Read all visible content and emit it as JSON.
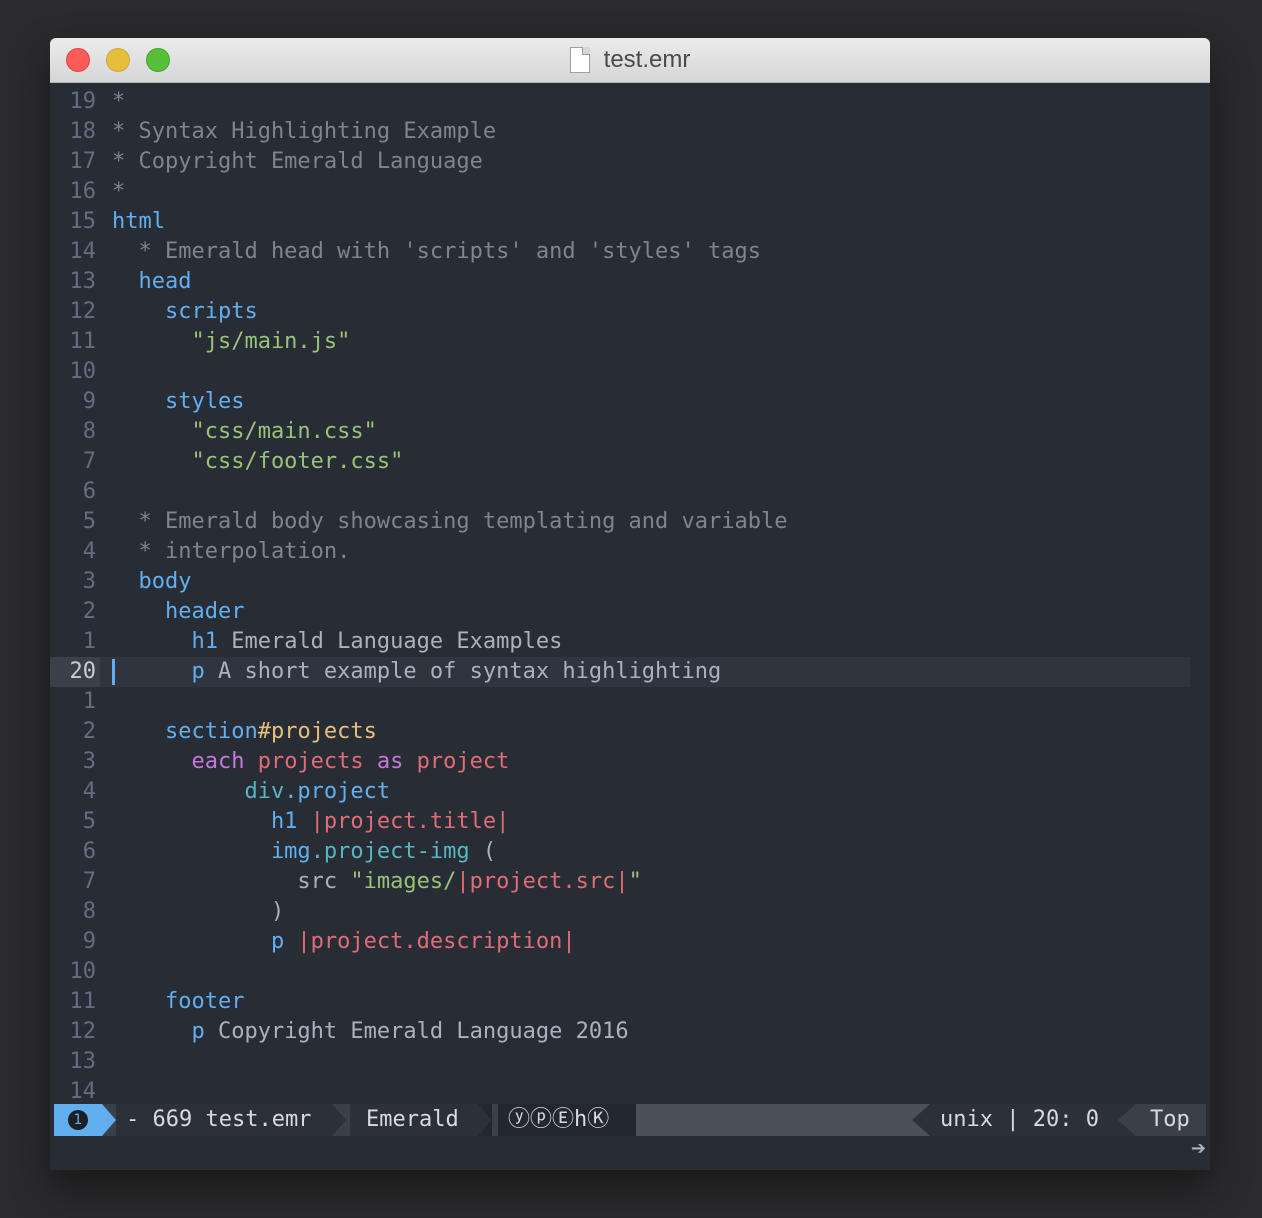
{
  "window": {
    "title": "test.emr"
  },
  "lines": [
    {
      "num": "19",
      "parts": [
        [
          "cm",
          "*"
        ]
      ]
    },
    {
      "num": "18",
      "parts": [
        [
          "cm",
          "* Syntax Highlighting Example"
        ]
      ]
    },
    {
      "num": "17",
      "parts": [
        [
          "cm",
          "* Copyright Emerald Language"
        ]
      ]
    },
    {
      "num": "16",
      "parts": [
        [
          "cm",
          "*"
        ]
      ]
    },
    {
      "num": "15",
      "parts": [
        [
          "kw",
          "html"
        ]
      ]
    },
    {
      "num": "14",
      "parts": [
        [
          "cm",
          "  * Emerald head with 'scripts' and 'styles' tags"
        ]
      ]
    },
    {
      "num": "13",
      "parts": [
        [
          "kw",
          "  head"
        ]
      ]
    },
    {
      "num": "12",
      "parts": [
        [
          "kw",
          "    scripts"
        ]
      ]
    },
    {
      "num": "11",
      "parts": [
        [
          "str",
          "      \"js/main.js\""
        ]
      ]
    },
    {
      "num": "10",
      "parts": []
    },
    {
      "num": "9",
      "parts": [
        [
          "kw",
          "    styles"
        ]
      ]
    },
    {
      "num": "8",
      "parts": [
        [
          "str",
          "      \"css/main.css\""
        ]
      ]
    },
    {
      "num": "7",
      "parts": [
        [
          "str",
          "      \"css/footer.css\""
        ]
      ]
    },
    {
      "num": "6",
      "parts": []
    },
    {
      "num": "5",
      "parts": [
        [
          "cm",
          "  * Emerald body showcasing templating and variable"
        ]
      ]
    },
    {
      "num": "4",
      "parts": [
        [
          "cm",
          "  * interpolation."
        ]
      ]
    },
    {
      "num": "3",
      "parts": [
        [
          "kw",
          "  body"
        ]
      ]
    },
    {
      "num": "2",
      "parts": [
        [
          "kw",
          "    header"
        ]
      ]
    },
    {
      "num": "1",
      "parts": [
        [
          "kw",
          "      h1"
        ],
        [
          "tx",
          " Emerald Language Examples"
        ]
      ]
    },
    {
      "num": "20",
      "current": true,
      "parts": [
        [
          "kw",
          "      p"
        ],
        [
          "tx",
          " A short example of syntax highlighting"
        ]
      ]
    },
    {
      "num": "1",
      "parts": []
    },
    {
      "num": "2",
      "parts": [
        [
          "kw",
          "    section"
        ],
        [
          "id",
          "#projects"
        ]
      ]
    },
    {
      "num": "3",
      "parts": [
        [
          "mg",
          "      each"
        ],
        [
          "rd",
          " projects"
        ],
        [
          "mg",
          " as"
        ],
        [
          "rd",
          " project"
        ]
      ]
    },
    {
      "num": "4",
      "parts": [
        [
          "cls",
          "          div"
        ],
        [
          "kw",
          ".project"
        ]
      ]
    },
    {
      "num": "5",
      "parts": [
        [
          "kw",
          "            h1"
        ],
        [
          "rd",
          " |project.title|"
        ]
      ]
    },
    {
      "num": "6",
      "parts": [
        [
          "kw",
          "            img"
        ],
        [
          "cls",
          ".project-img"
        ],
        [
          "tx",
          " ("
        ]
      ]
    },
    {
      "num": "7",
      "parts": [
        [
          "tx",
          "              src "
        ],
        [
          "str",
          "\"images/"
        ],
        [
          "rd",
          "|project.src|"
        ],
        [
          "str",
          "\""
        ]
      ]
    },
    {
      "num": "8",
      "parts": [
        [
          "tx",
          "            )"
        ]
      ]
    },
    {
      "num": "9",
      "parts": [
        [
          "kw",
          "            p"
        ],
        [
          "rd",
          " |project.description|"
        ]
      ]
    },
    {
      "num": "10",
      "parts": []
    },
    {
      "num": "11",
      "parts": [
        [
          "kw",
          "    footer"
        ]
      ]
    },
    {
      "num": "12",
      "parts": [
        [
          "kw",
          "      p"
        ],
        [
          "tx",
          " Copyright Emerald Language 2016"
        ]
      ]
    },
    {
      "num": "13",
      "parts": []
    },
    {
      "num": "14",
      "parts": []
    }
  ],
  "statusbar": {
    "window_number": "1",
    "file_info": "- 669 test.emr",
    "major_mode": "Emerald",
    "minor_modes": "ⓨⓟⒺhⓀ",
    "encoding": "unix | 20: 0",
    "position": "Top"
  },
  "echo": {
    "wrap_icon": "wrap-arrow-icon",
    "wrap_glyph": "➔"
  },
  "colors": {
    "background": "#282c34",
    "keyword": "#61afef",
    "string": "#98c379",
    "comment": "#7f848e",
    "id": "#e5c07b",
    "magenta": "#c678dd",
    "variable": "#e06c75",
    "class": "#56b6c2"
  }
}
